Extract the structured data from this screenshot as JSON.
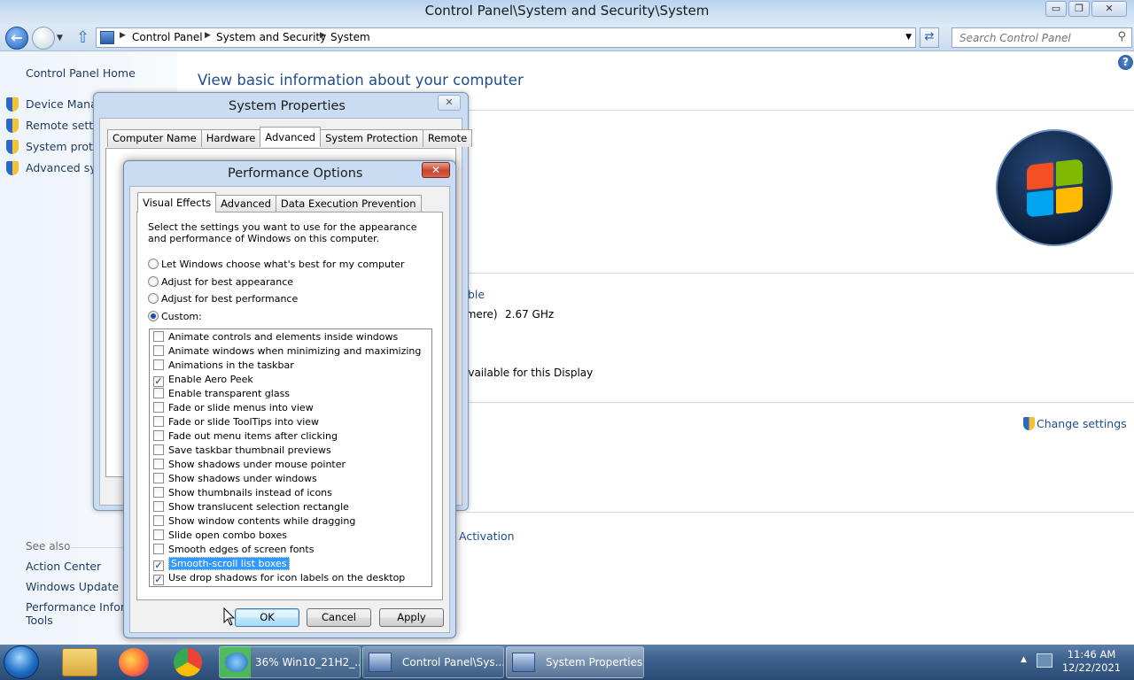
{
  "window": {
    "title": "Control Panel\\System and Security\\System",
    "minimize": "▭",
    "maximize": "❐",
    "close": "✕"
  },
  "addressbar": {
    "breadcrumbs": [
      "Control Panel",
      "System and Security",
      "System"
    ],
    "search_placeholder": "Search Control Panel"
  },
  "leftpane": {
    "home": "Control Panel Home",
    "links": [
      "Device Manag",
      "Remote setting",
      "System protec",
      "Advanced syst"
    ],
    "see_also": "See also",
    "see_also_links": [
      "Action Center",
      "Windows Update",
      "Performance Inform",
      "Tools"
    ]
  },
  "main": {
    "heading": "View basic information about your computer",
    "partial_texts": [
      "ble",
      "tmere)",
      "2.67 GHz",
      "available for this Display",
      "Change settings",
      "Activation"
    ]
  },
  "system_properties": {
    "title": "System Properties",
    "tabs": [
      "Computer Name",
      "Hardware",
      "Advanced",
      "System Protection",
      "Remote"
    ],
    "selected_tab": "Advanced"
  },
  "performance_options": {
    "title": "Performance Options",
    "tabs": [
      "Visual Effects",
      "Advanced",
      "Data Execution Prevention"
    ],
    "selected_tab": "Visual Effects",
    "description": "Select the settings you want to use for the appearance and performance of Windows on this computer.",
    "radios": [
      {
        "label": "Let Windows choose what's best for my computer",
        "checked": false
      },
      {
        "label": "Adjust for best appearance",
        "checked": false
      },
      {
        "label": "Adjust for best performance",
        "checked": false
      },
      {
        "label": "Custom:",
        "checked": true
      }
    ],
    "effects": [
      {
        "label": "Animate controls and elements inside windows",
        "checked": false
      },
      {
        "label": "Animate windows when minimizing and maximizing",
        "checked": false
      },
      {
        "label": "Animations in the taskbar",
        "checked": false
      },
      {
        "label": "Enable Aero Peek",
        "checked": true
      },
      {
        "label": "Enable transparent glass",
        "checked": false
      },
      {
        "label": "Fade or slide menus into view",
        "checked": false
      },
      {
        "label": "Fade or slide ToolTips into view",
        "checked": false
      },
      {
        "label": "Fade out menu items after clicking",
        "checked": false
      },
      {
        "label": "Save taskbar thumbnail previews",
        "checked": false
      },
      {
        "label": "Show shadows under mouse pointer",
        "checked": false
      },
      {
        "label": "Show shadows under windows",
        "checked": false
      },
      {
        "label": "Show thumbnails instead of icons",
        "checked": false
      },
      {
        "label": "Show translucent selection rectangle",
        "checked": false
      },
      {
        "label": "Show window contents while dragging",
        "checked": false
      },
      {
        "label": "Slide open combo boxes",
        "checked": false
      },
      {
        "label": "Smooth edges of screen fonts",
        "checked": false
      },
      {
        "label": "Smooth-scroll list boxes",
        "checked": true,
        "selected": true
      },
      {
        "label": "Use drop shadows for icon labels on the desktop",
        "checked": true
      }
    ],
    "buttons": {
      "ok": "OK",
      "cancel": "Cancel",
      "apply": "Apply"
    },
    "close": "✕"
  },
  "taskbar": {
    "tasks": [
      "36% Win10_21H2_...",
      "Control Panel\\Sys...",
      "System Properties"
    ],
    "time": "11:46 AM",
    "date": "12/22/2021"
  },
  "colors": {
    "link": "#1e4e8c",
    "selection": "#3399ff",
    "taskbar": "#3d628e"
  }
}
